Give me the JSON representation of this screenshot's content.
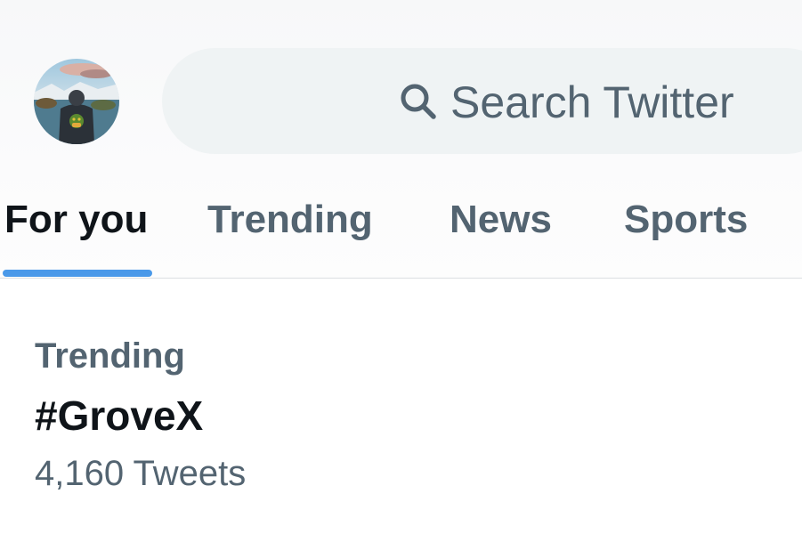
{
  "search": {
    "placeholder": "Search Twitter",
    "icon": "search-icon"
  },
  "avatar": {
    "icon": "profile-avatar"
  },
  "tabs": [
    {
      "label": "For you",
      "active": true
    },
    {
      "label": "Trending",
      "active": false
    },
    {
      "label": "News",
      "active": false
    },
    {
      "label": "Sports",
      "active": false
    }
  ],
  "colors": {
    "accent": "#4a99e9",
    "primary_text": "#0f1419",
    "secondary_text": "#536471",
    "search_background": "#eff3f4"
  },
  "trends": [
    {
      "category": "Trending",
      "name": "#GroveX",
      "count": "4,160 Tweets"
    }
  ]
}
